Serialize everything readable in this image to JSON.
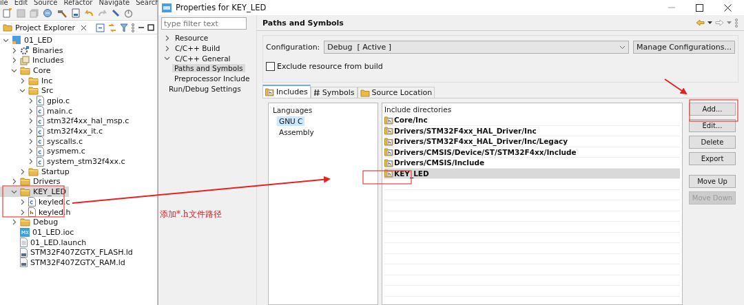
{
  "ide_menu": [
    "ile",
    "Edit",
    "Source",
    "Refactor",
    "Navigate",
    "Search"
  ],
  "project_explorer": {
    "title": "Project Explorer",
    "tree": [
      {
        "label": "01_LED",
        "kind": "project",
        "expanded": true,
        "selected": false,
        "children": [
          {
            "label": "Binaries",
            "kind": "binaries",
            "expanded": false,
            "selected": false
          },
          {
            "label": "Includes",
            "kind": "includes",
            "expanded": false,
            "selected": false
          },
          {
            "label": "Core",
            "kind": "folder",
            "expanded": true,
            "selected": false,
            "children": [
              {
                "label": "Inc",
                "kind": "folder",
                "expanded": false,
                "selected": false
              },
              {
                "label": "Src",
                "kind": "folder",
                "expanded": true,
                "selected": false,
                "children": [
                  {
                    "label": "gpio.c",
                    "kind": "c-file",
                    "expanded": false,
                    "selected": false
                  },
                  {
                    "label": "main.c",
                    "kind": "c-file",
                    "expanded": false,
                    "selected": false
                  },
                  {
                    "label": "stm32f4xx_hal_msp.c",
                    "kind": "c-file",
                    "expanded": false,
                    "selected": false
                  },
                  {
                    "label": "stm32f4xx_it.c",
                    "kind": "c-file",
                    "expanded": false,
                    "selected": false
                  },
                  {
                    "label": "syscalls.c",
                    "kind": "c-file",
                    "expanded": false,
                    "selected": false
                  },
                  {
                    "label": "sysmem.c",
                    "kind": "c-file",
                    "expanded": false,
                    "selected": false
                  },
                  {
                    "label": "system_stm32f4xx.c",
                    "kind": "c-file",
                    "expanded": false,
                    "selected": false
                  }
                ]
              },
              {
                "label": "Startup",
                "kind": "folder",
                "expanded": false,
                "selected": false
              }
            ]
          },
          {
            "label": "Drivers",
            "kind": "folder",
            "expanded": false,
            "selected": false
          },
          {
            "label": "KEY_LED",
            "kind": "folder",
            "expanded": true,
            "selected": true,
            "children": [
              {
                "label": "keyled.c",
                "kind": "c-file",
                "expanded": false,
                "selected": false
              },
              {
                "label": "keyled.h",
                "kind": "h-file",
                "expanded": false,
                "selected": false
              }
            ]
          },
          {
            "label": "Debug",
            "kind": "folder",
            "expanded": false,
            "selected": false
          },
          {
            "label": "01_LED.ioc",
            "kind": "ioc",
            "selected": false
          },
          {
            "label": "01_LED.launch",
            "kind": "file",
            "selected": false
          },
          {
            "label": "STM32F407ZGTX_FLASH.ld",
            "kind": "ld",
            "selected": false
          },
          {
            "label": "STM32F407ZGTX_RAM.ld",
            "kind": "ld",
            "selected": false
          }
        ]
      }
    ]
  },
  "dialog": {
    "title": "Properties for KEY_LED",
    "filter": {
      "placeholder": "type filter text"
    },
    "nav": [
      {
        "label": "Resource",
        "expanded": false,
        "selected": false
      },
      {
        "label": "C/C++ Build",
        "expanded": false,
        "selected": false
      },
      {
        "label": "C/C++ General",
        "expanded": true,
        "selected": false,
        "children": [
          {
            "label": "Paths and Symbols",
            "selected": true
          },
          {
            "label": "Preprocessor Include",
            "selected": false
          }
        ]
      },
      {
        "label": "Run/Debug Settings",
        "selected": false
      }
    ],
    "page_title": "Paths and Symbols",
    "configuration": {
      "label": "Configuration:",
      "value": "Debug  [ Active ]",
      "button": "Manage Configurations..."
    },
    "exclude": {
      "label": "Exclude resource from build",
      "checked": false
    },
    "tabs": [
      {
        "label": "Includes",
        "kind": "includes",
        "selected": true
      },
      {
        "label": "Symbols",
        "kind": "symbols",
        "selected": false
      },
      {
        "label": "Source Location",
        "kind": "source",
        "selected": false
      }
    ],
    "languages": {
      "title": "Languages",
      "items": [
        {
          "label": "GNU C",
          "selected": true
        },
        {
          "label": "Assembly",
          "selected": false
        }
      ]
    },
    "include_dirs": {
      "title": "Include directories",
      "rows": [
        {
          "path": "Core/Inc",
          "selected": false
        },
        {
          "path": "Drivers/STM32F4xx_HAL_Driver/Inc",
          "selected": false
        },
        {
          "path": "Drivers/STM32F4xx_HAL_Driver/Inc/Legacy",
          "selected": false
        },
        {
          "path": "Drivers/CMSIS/Device/ST/STM32F4xx/Include",
          "selected": false
        },
        {
          "path": "Drivers/CMSIS/Include",
          "selected": false
        },
        {
          "path": "KEY_LED",
          "selected": true
        }
      ]
    },
    "button_groups": [
      [
        {
          "label": "Add...",
          "disabled": false
        },
        {
          "label": "Edit...",
          "disabled": false
        },
        {
          "label": "Delete",
          "disabled": false
        },
        {
          "label": "Export",
          "disabled": false
        }
      ],
      [
        {
          "label": "Move Up",
          "disabled": false
        },
        {
          "label": "Move Down",
          "disabled": true
        }
      ]
    ]
  },
  "annotation": {
    "note": "添加*.h文件路径"
  }
}
